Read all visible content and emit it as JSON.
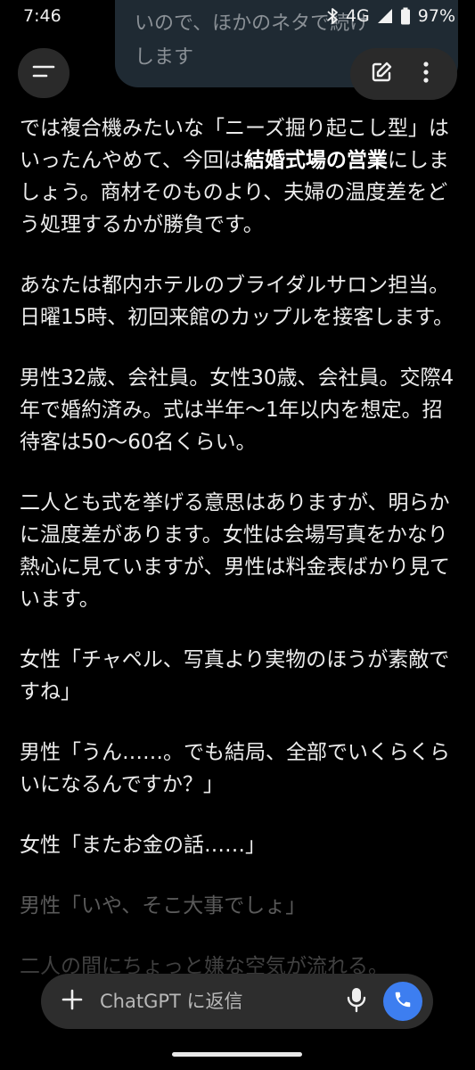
{
  "status_bar": {
    "time": "7:46",
    "network": "4G",
    "battery": "97%"
  },
  "user_bubble": {
    "lines": [
      "いので、ほかのネタで続け",
      "します"
    ]
  },
  "composer": {
    "placeholder": "ChatGPT に返信"
  },
  "message": {
    "paragraphs": [
      {
        "segments": [
          {
            "text": "では複合機みたいな「ニーズ掘り起こし型」はいったんやめて、今回は",
            "bold": false
          },
          {
            "text": "結婚式場の営業",
            "bold": true
          },
          {
            "text": "にしましょう。商材そのものより、夫婦の温度差をどう処理するかが勝負です。",
            "bold": false
          }
        ]
      },
      {
        "segments": [
          {
            "text": "あなたは都内ホテルのブライダルサロン担当。日曜15時、初回来館のカップルを接客します。",
            "bold": false
          }
        ]
      },
      {
        "segments": [
          {
            "text": "男性32歳、会社員。女性30歳、会社員。交際4年で婚約済み。式は半年〜1年以内を想定。招待客は50〜60名くらい。",
            "bold": false
          }
        ]
      },
      {
        "segments": [
          {
            "text": "二人とも式を挙げる意思はありますが、明らかに温度差があります。女性は会場写真をかなり熱心に見ていますが、男性は料金表ばかり見ています。",
            "bold": false
          }
        ]
      },
      {
        "segments": [
          {
            "text": "女性「チャペル、写真より実物のほうが素敵ですね」",
            "bold": false
          }
        ]
      },
      {
        "segments": [
          {
            "text": "男性「うん……。でも結局、全部でいくらくらいになるんですか？」",
            "bold": false
          }
        ]
      },
      {
        "segments": [
          {
            "text": "女性「またお金の話……」",
            "bold": false
          }
        ]
      },
      {
        "segments": [
          {
            "text": "男性「いや、そこ大事でしょ」",
            "bold": false
          }
        ]
      },
      {
        "segments": [
          {
            "text": "二人の間にちょっと嫌な空気が流れる。",
            "bold": false
          }
        ]
      }
    ]
  },
  "icons": {
    "menu": "menu-icon",
    "new_chat": "edit-icon",
    "more": "more-vertical-icon",
    "plus": "plus-icon",
    "mic": "mic-icon",
    "voice": "phone-icon"
  },
  "colors": {
    "background": "#000000",
    "accent": "#3d7ef0",
    "surface": "#2d2d2d"
  }
}
